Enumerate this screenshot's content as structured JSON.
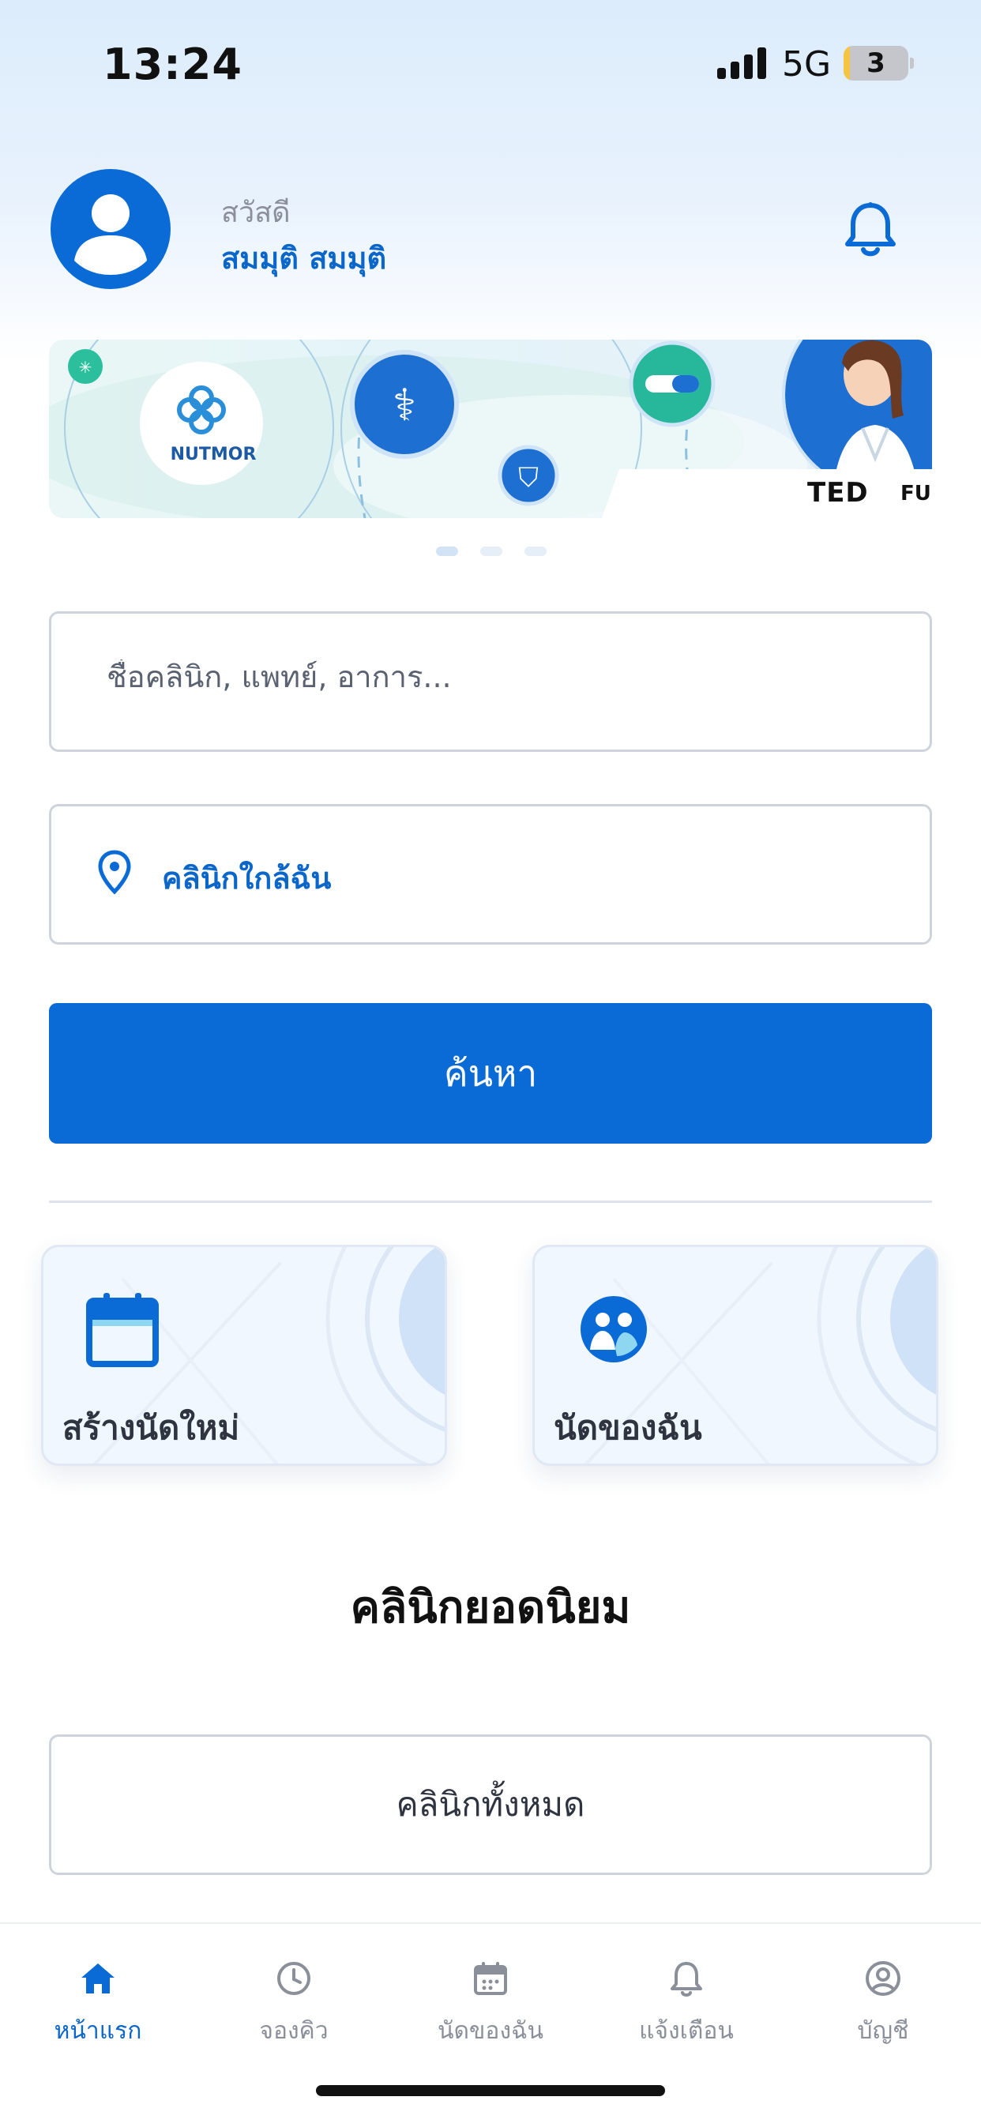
{
  "status_bar": {
    "time": "13:24",
    "network": "5G",
    "battery": "3"
  },
  "header": {
    "greeting": "สวัสดี",
    "user_name": "สมมุติ สมมุติ",
    "avatar_icon": "user-avatar-icon",
    "notification_icon": "bell-icon"
  },
  "banner": {
    "logo_text": "NUTMOR",
    "partner_text": "TED",
    "partner_text_suffix": "FUND",
    "slides_total": 3,
    "active_slide": 1
  },
  "search": {
    "placeholder": "ชื่อคลินิก, แพทย์, อาการ...",
    "value": "",
    "location_label": "คลินิกใกล้ฉัน",
    "location_icon": "map-pin-icon",
    "button_label": "ค้นหา"
  },
  "quick_actions": {
    "new_appointment": {
      "label": "สร้างนัดใหม่",
      "icon": "calendar-icon"
    },
    "my_appointments": {
      "label": "นัดของฉัน",
      "icon": "users-circle-icon"
    }
  },
  "popular": {
    "title": "คลินิกยอดนิยม",
    "all_clinics_label": "คลินิกทั้งหมด"
  },
  "bottom_nav": {
    "items": [
      {
        "label": "หน้าแรก",
        "icon": "home-icon",
        "active": true
      },
      {
        "label": "จองคิว",
        "icon": "clock-icon",
        "active": false
      },
      {
        "label": "นัดของฉัน",
        "icon": "calendar-icon",
        "active": false
      },
      {
        "label": "แจ้งเตือน",
        "icon": "bell-icon",
        "active": false
      },
      {
        "label": "บัญชี",
        "icon": "account-icon",
        "active": false
      }
    ]
  },
  "colors": {
    "primary": "#0a6bd6",
    "accent_text": "#0a66c9",
    "inactive": "#8a8f99"
  }
}
